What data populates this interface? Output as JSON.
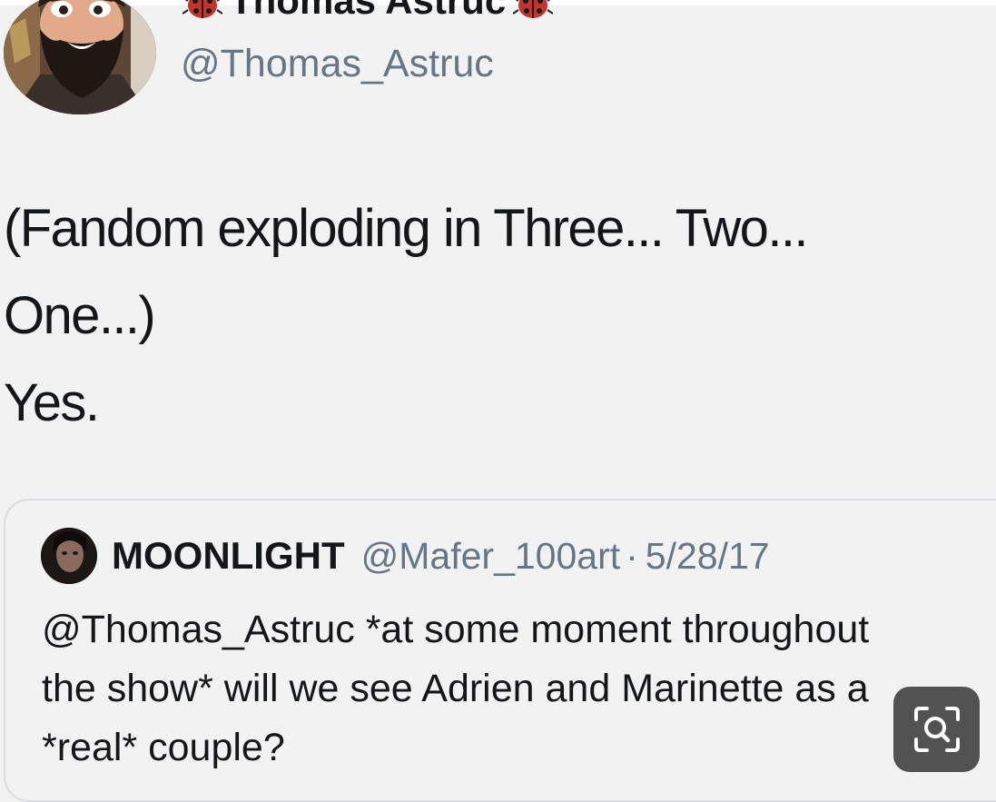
{
  "tweet": {
    "display_name": "Thomas Astruc",
    "handle": "@Thomas_Astruc",
    "avatar_icon": "bearded-man-avatar",
    "name_badge_icon": "ladybug-emoji",
    "text_lines": [
      "(Fandom exploding in Three... Two...",
      "One...)",
      "Yes."
    ]
  },
  "quoted_tweet": {
    "display_name": "MOONLIGHT",
    "handle": "@Mafer_100art",
    "separator": "·",
    "date": "5/28/17",
    "avatar_icon": "user-avatar",
    "text_lines": [
      "@Thomas_Astruc *at some moment throughout",
      "the show* will we see Adrien and Marinette as a",
      "*real* couple?"
    ]
  },
  "overlay": {
    "lens_button_icon": "visual-search-icon"
  },
  "colors": {
    "background": "#f2f2f3",
    "text": "#14171a",
    "secondary_text": "#657786",
    "card_border": "#d9dde1",
    "overlay_button": "#444444"
  }
}
